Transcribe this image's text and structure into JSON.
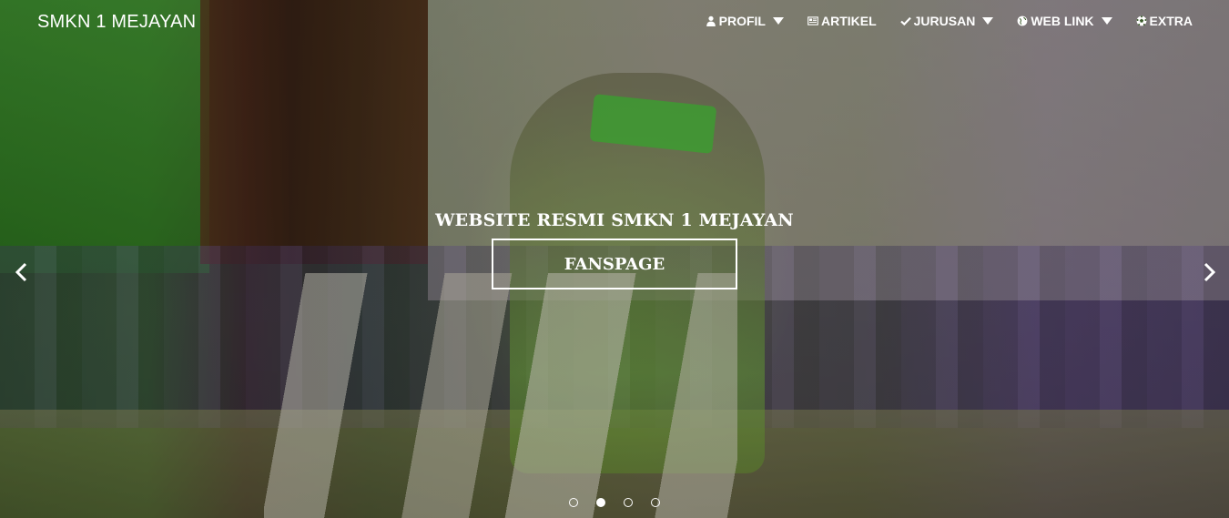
{
  "nav": {
    "brand": "SMKN 1 MEJAYAN",
    "items": [
      {
        "label": "PROFIL",
        "icon": "user-icon",
        "dropdown": true
      },
      {
        "label": "ARTIKEL",
        "icon": "newspaper-icon",
        "dropdown": false
      },
      {
        "label": "JURUSAN",
        "icon": "check-icon",
        "dropdown": true
      },
      {
        "label": "WEB LINK",
        "icon": "globe-icon",
        "dropdown": true
      },
      {
        "label": "EXTRA",
        "icon": "soccer-ball-icon",
        "dropdown": false
      }
    ]
  },
  "carousel": {
    "caption_title": "WEBSITE RESMI SMKN 1 MEJAYAN",
    "button_label": "FANSPAGE",
    "slide_count": 4,
    "active_index": 1
  },
  "colors": {
    "text": "#ffffff",
    "accent_green": "#47c23a"
  }
}
